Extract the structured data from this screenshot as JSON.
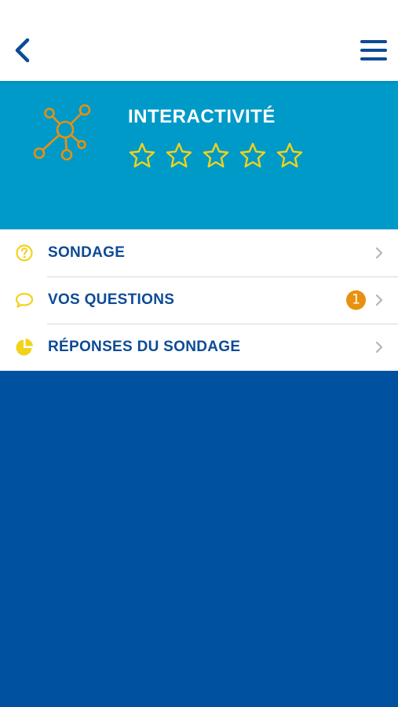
{
  "header": {
    "back_icon": "chevron-left-icon",
    "menu_icon": "hamburger-menu-icon"
  },
  "hero": {
    "title": "INTERACTIVITÉ",
    "icon": "network-nodes-icon",
    "rating": {
      "value": 0,
      "max": 5
    }
  },
  "menu": {
    "items": [
      {
        "label": "SONDAGE",
        "icon": "question-circle-icon"
      },
      {
        "label": "VOS QUESTIONS",
        "icon": "speech-bubble-icon",
        "badge": "1"
      },
      {
        "label": "RÉPONSES DU SONDAGE",
        "icon": "pie-chart-icon"
      }
    ]
  },
  "colors": {
    "brand_blue": "#0052a0",
    "label_blue": "#0c4b96",
    "hero_cyan": "#009ac8",
    "accent_orange": "#e8900f",
    "accent_yellow": "#f2d21b",
    "chevron_gray": "#b5b5b5"
  }
}
